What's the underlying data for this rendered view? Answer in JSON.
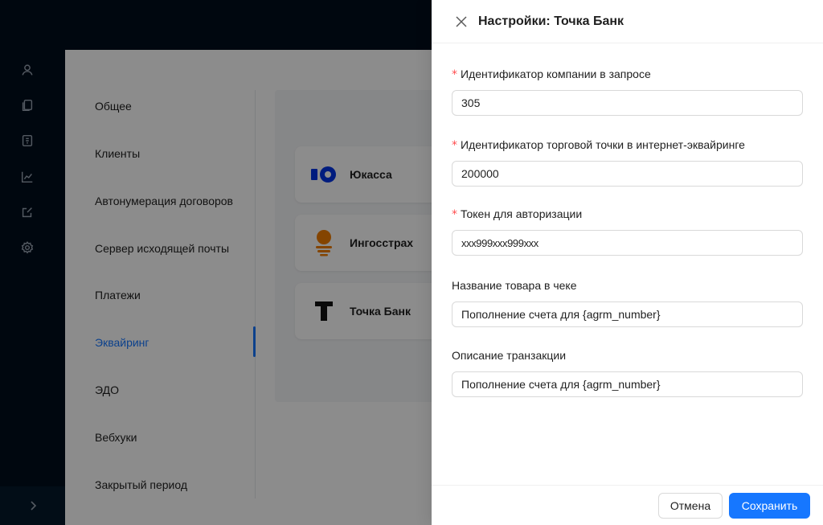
{
  "menu": {
    "items": [
      {
        "label": "Общее"
      },
      {
        "label": "Клиенты"
      },
      {
        "label": "Автонумерация договоров"
      },
      {
        "label": "Сервер исходящей почты"
      },
      {
        "label": "Платежи"
      },
      {
        "label": "Эквайринг"
      },
      {
        "label": "ЭДО"
      },
      {
        "label": "Вебхуки"
      },
      {
        "label": "Закрытый период"
      }
    ],
    "active_index": 5
  },
  "providers": [
    {
      "name": "Юкасса",
      "logo": "yookassa-logo"
    },
    {
      "name": "Ингосстрах",
      "logo": "ingosstrakh-logo"
    },
    {
      "name": "Точка Банк",
      "logo": "tochka-logo"
    }
  ],
  "rail": {
    "icons": [
      "user-icon",
      "documents-icon",
      "invoice-icon",
      "chart-icon",
      "edit-icon",
      "gear-icon"
    ],
    "expand_icon": "chevron-right-icon"
  },
  "drawer": {
    "title": "Настройки: Точка Банк",
    "fields": [
      {
        "label": "Идентификатор компании в запросе",
        "required": true,
        "value": "305"
      },
      {
        "label": "Идентификатор торговой точки в интернет-эквайринге",
        "required": true,
        "value": "200000"
      },
      {
        "label": "Токен для авторизации",
        "required": true,
        "value": "xxx999xxx999xxx"
      },
      {
        "label": "Название товара в чеке",
        "required": false,
        "value": "Пополнение счета для {agrm_number}"
      },
      {
        "label": "Описание транзакции",
        "required": false,
        "value": "Пополнение счета для {agrm_number}"
      }
    ],
    "cancel_label": "Отмена",
    "save_label": "Сохранить"
  },
  "colors": {
    "accent": "#1677ff",
    "nav_bg": "#000e1d",
    "required": "#ff4d4f"
  }
}
